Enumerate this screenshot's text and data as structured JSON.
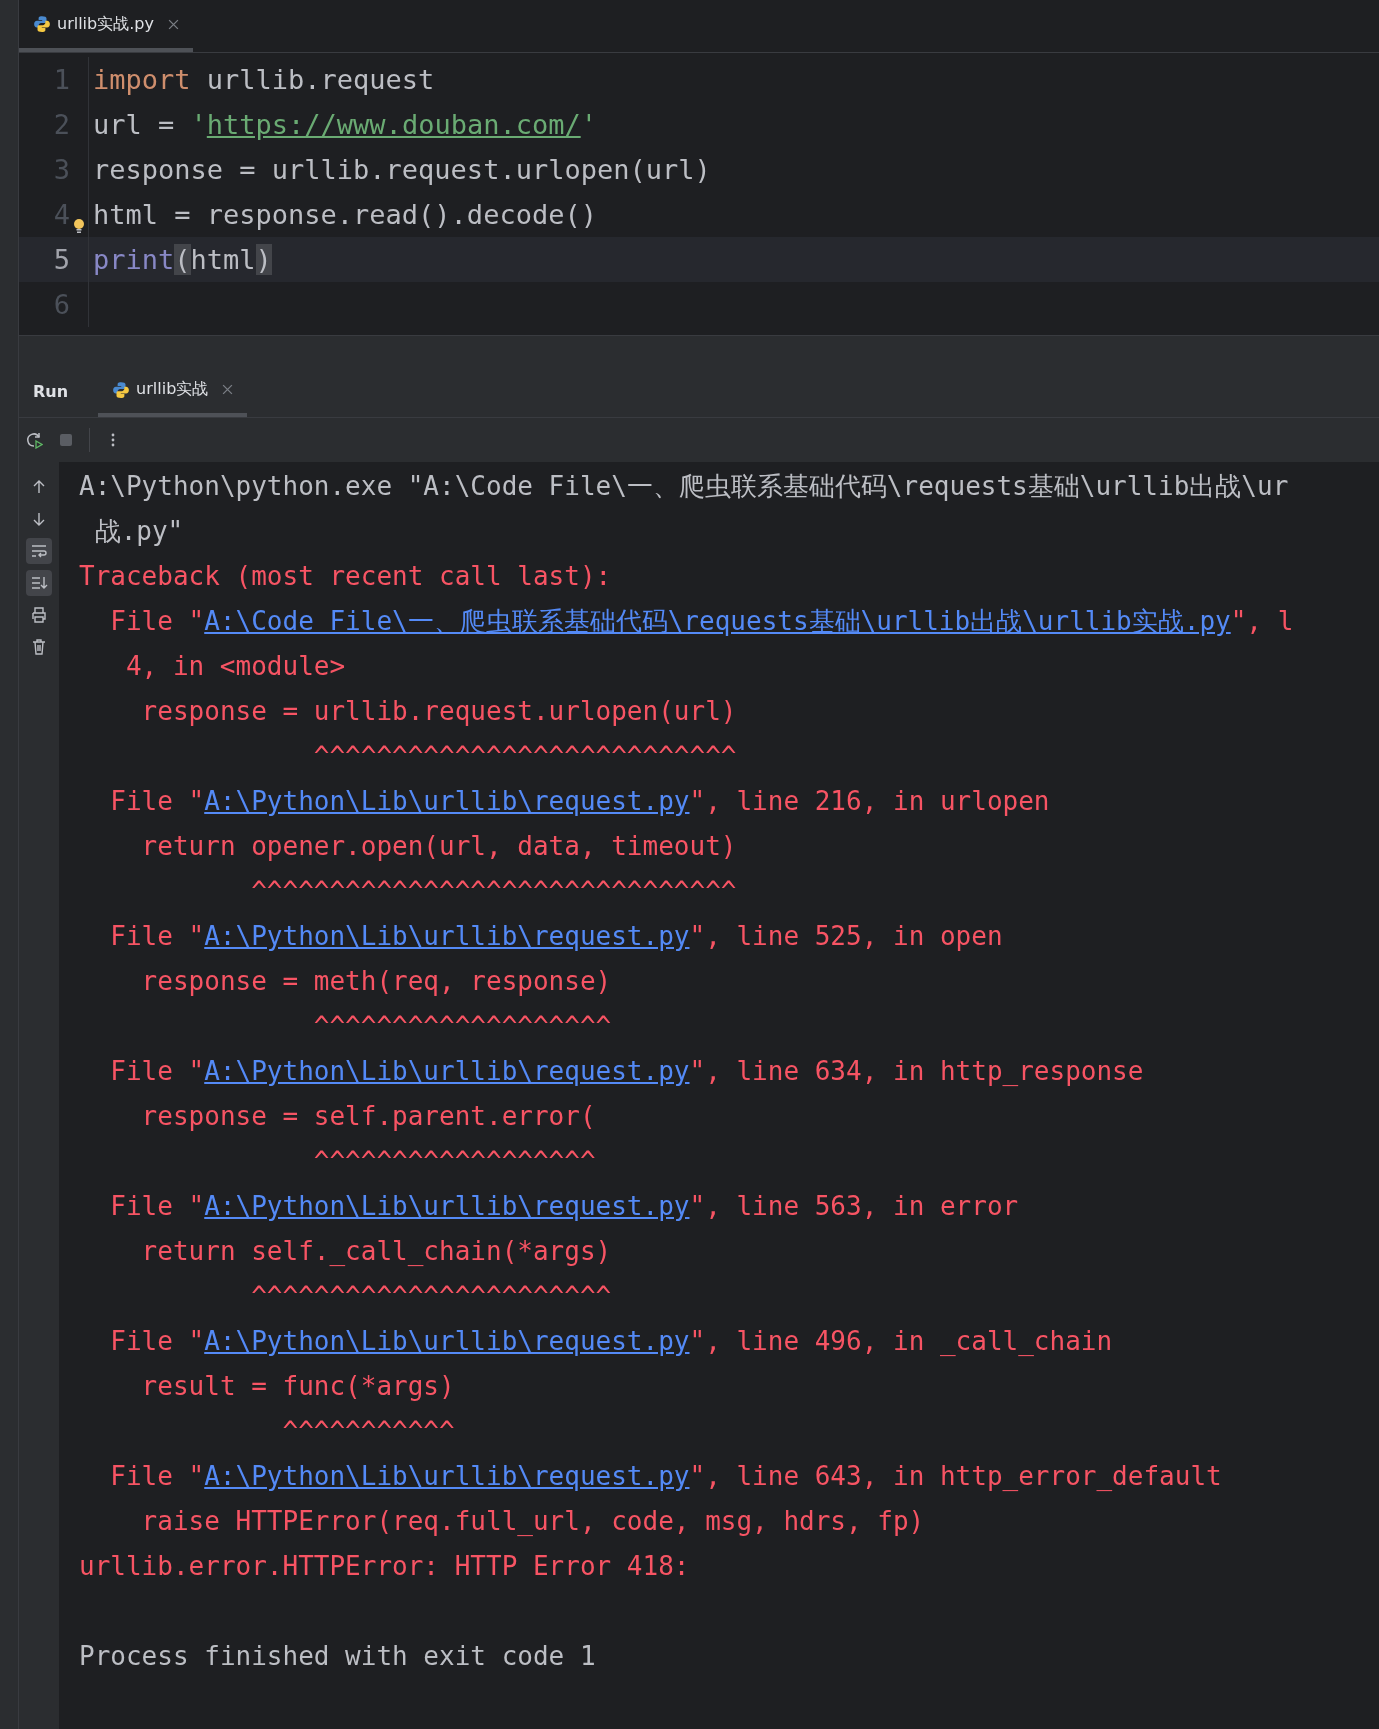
{
  "editor_tabs": [
    {
      "label": "urllib实战.py",
      "selected": true
    }
  ],
  "editor": {
    "lines": [
      {
        "number": "1",
        "current": false,
        "bulb": false,
        "tokens": [
          {
            "kind": "keyword",
            "text": "import "
          },
          {
            "kind": "plain",
            "text": "urllib.request"
          }
        ]
      },
      {
        "number": "2",
        "current": false,
        "bulb": false,
        "tokens": [
          {
            "kind": "plain",
            "text": "url = "
          },
          {
            "kind": "string",
            "text": "'"
          },
          {
            "kind": "url",
            "text": "https://www.douban.com/"
          },
          {
            "kind": "string",
            "text": "'"
          }
        ]
      },
      {
        "number": "3",
        "current": false,
        "bulb": false,
        "tokens": [
          {
            "kind": "plain",
            "text": "response = urllib.request.urlopen(url)"
          }
        ]
      },
      {
        "number": "4",
        "current": false,
        "bulb": true,
        "tokens": [
          {
            "kind": "plain",
            "text": "html = response.read().decode()"
          }
        ]
      },
      {
        "number": "5",
        "current": true,
        "bulb": false,
        "tokens": [
          {
            "kind": "builtin",
            "text": "print"
          },
          {
            "kind": "match",
            "text": "("
          },
          {
            "kind": "plain",
            "text": "html"
          },
          {
            "kind": "match",
            "text": ")"
          }
        ]
      },
      {
        "number": "6",
        "current": false,
        "bulb": false
      }
    ]
  },
  "run_panel": {
    "title": "Run",
    "tabs": [
      {
        "label": "urllib实战",
        "selected": true
      }
    ],
    "side_tools": [
      {
        "kind": "up",
        "on": false
      },
      {
        "kind": "down",
        "on": false
      },
      {
        "kind": "wrap",
        "on": true
      },
      {
        "kind": "scroll-end",
        "on": true
      },
      {
        "kind": "print",
        "on": false
      },
      {
        "kind": "trash",
        "on": false
      }
    ],
    "console": [
      {
        "kind": "top",
        "segments": [
          {
            "kind": "plain",
            "text": "A:\\Python\\python.exe \"A:\\Code File\\一、爬虫联系基础代码\\requests基础\\urllib出战\\ur"
          }
        ]
      },
      {
        "kind": "wrap",
        "segments": [
          {
            "kind": "plain",
            "text": "战.py\""
          }
        ]
      },
      {
        "kind": "top",
        "segments": [
          {
            "kind": "error",
            "text": "Traceback (most recent call last):"
          }
        ]
      },
      {
        "kind": "frame",
        "segments": [
          {
            "kind": "error",
            "text": "File \""
          },
          {
            "kind": "link",
            "text": "A:\\Code File\\一、爬虫联系基础代码\\requests基础\\urllib出战\\urllib实战.py"
          },
          {
            "kind": "error",
            "text": "\", l"
          }
        ]
      },
      {
        "kind": "frame-wrap",
        "segments": [
          {
            "kind": "error",
            "text": "4, in <module>"
          }
        ]
      },
      {
        "kind": "source",
        "segments": [
          {
            "kind": "error",
            "text": "response = urllib.request.urlopen(url)"
          }
        ]
      },
      {
        "kind": "source",
        "segments": [
          {
            "kind": "error",
            "text": "           ^^^^^^^^^^^^^^^^^^^^^^^^^^^"
          }
        ]
      },
      {
        "kind": "frame",
        "segments": [
          {
            "kind": "error",
            "text": "File \""
          },
          {
            "kind": "link",
            "text": "A:\\Python\\Lib\\urllib\\request.py"
          },
          {
            "kind": "error",
            "text": "\", line 216, in urlopen"
          }
        ]
      },
      {
        "kind": "source",
        "segments": [
          {
            "kind": "error",
            "text": "return opener.open(url, data, timeout)"
          }
        ]
      },
      {
        "kind": "source",
        "segments": [
          {
            "kind": "error",
            "text": "       ^^^^^^^^^^^^^^^^^^^^^^^^^^^^^^^"
          }
        ]
      },
      {
        "kind": "frame",
        "segments": [
          {
            "kind": "error",
            "text": "File \""
          },
          {
            "kind": "link",
            "text": "A:\\Python\\Lib\\urllib\\request.py"
          },
          {
            "kind": "error",
            "text": "\", line 525, in open"
          }
        ]
      },
      {
        "kind": "source",
        "segments": [
          {
            "kind": "error",
            "text": "response = meth(req, response)"
          }
        ]
      },
      {
        "kind": "source",
        "segments": [
          {
            "kind": "error",
            "text": "           ^^^^^^^^^^^^^^^^^^^"
          }
        ]
      },
      {
        "kind": "frame",
        "segments": [
          {
            "kind": "error",
            "text": "File \""
          },
          {
            "kind": "link",
            "text": "A:\\Python\\Lib\\urllib\\request.py"
          },
          {
            "kind": "error",
            "text": "\", line 634, in http_response"
          }
        ]
      },
      {
        "kind": "source",
        "segments": [
          {
            "kind": "error",
            "text": "response = self.parent.error("
          }
        ]
      },
      {
        "kind": "source",
        "segments": [
          {
            "kind": "error",
            "text": "           ^^^^^^^^^^^^^^^^^^"
          }
        ]
      },
      {
        "kind": "frame",
        "segments": [
          {
            "kind": "error",
            "text": "File \""
          },
          {
            "kind": "link",
            "text": "A:\\Python\\Lib\\urllib\\request.py"
          },
          {
            "kind": "error",
            "text": "\", line 563, in error"
          }
        ]
      },
      {
        "kind": "source",
        "segments": [
          {
            "kind": "error",
            "text": "return self._call_chain(*args)"
          }
        ]
      },
      {
        "kind": "source",
        "segments": [
          {
            "kind": "error",
            "text": "       ^^^^^^^^^^^^^^^^^^^^^^^"
          }
        ]
      },
      {
        "kind": "frame",
        "segments": [
          {
            "kind": "error",
            "text": "File \""
          },
          {
            "kind": "link",
            "text": "A:\\Python\\Lib\\urllib\\request.py"
          },
          {
            "kind": "error",
            "text": "\", line 496, in _call_chain"
          }
        ]
      },
      {
        "kind": "source",
        "segments": [
          {
            "kind": "error",
            "text": "result = func(*args)"
          }
        ]
      },
      {
        "kind": "source",
        "segments": [
          {
            "kind": "error",
            "text": "         ^^^^^^^^^^^"
          }
        ]
      },
      {
        "kind": "frame",
        "segments": [
          {
            "kind": "error",
            "text": "File \""
          },
          {
            "kind": "link",
            "text": "A:\\Python\\Lib\\urllib\\request.py"
          },
          {
            "kind": "error",
            "text": "\", line 643, in http_error_default"
          }
        ]
      },
      {
        "kind": "source",
        "segments": [
          {
            "kind": "error",
            "text": "raise HTTPError(req.full_url, code, msg, hdrs, fp)"
          }
        ]
      },
      {
        "kind": "top",
        "segments": [
          {
            "kind": "error",
            "text": "urllib.error.HTTPError: HTTP Error 418:"
          }
        ]
      },
      {
        "kind": "blank"
      },
      {
        "kind": "top",
        "segments": [
          {
            "kind": "plain",
            "text": "Process finished with exit code 1"
          }
        ]
      }
    ]
  }
}
